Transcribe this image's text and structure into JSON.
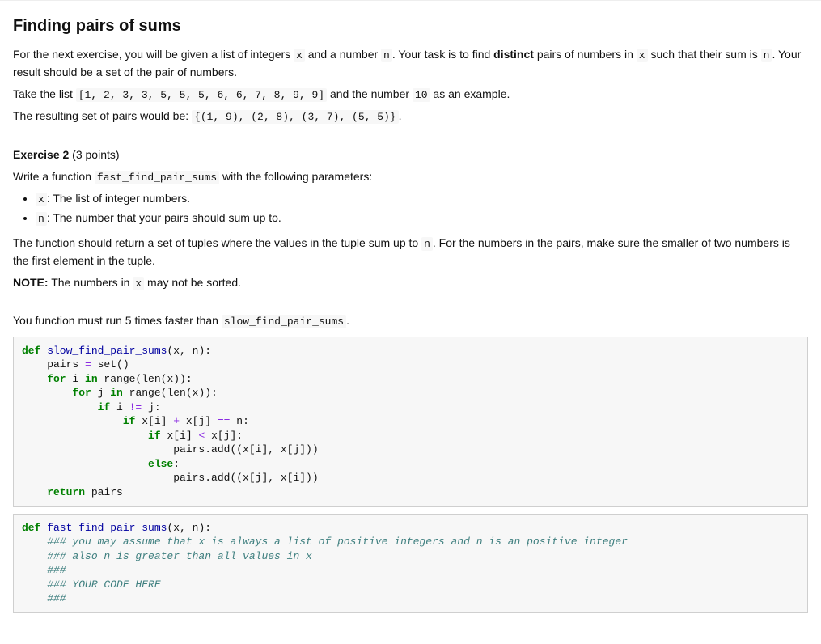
{
  "title": "Finding pairs of sums",
  "intro_p1_a": "For the next exercise, you will be given a list of integers ",
  "intro_p1_b": " and a number ",
  "intro_p1_c": ". Your task is to find ",
  "intro_p1_bold": "distinct",
  "intro_p1_d": " pairs of numbers in ",
  "intro_p1_e": " such that their sum is ",
  "intro_p1_f": ". Your result should be a set of the pair of numbers.",
  "intro_p2_a": "Take the list ",
  "intro_p2_list": "[1, 2, 3, 3, 5, 5, 5, 6, 6, 7, 8, 9, 9]",
  "intro_p2_b": " and the number ",
  "intro_p2_num": "10",
  "intro_p2_c": " as an example.",
  "intro_p3_a": "The resulting set of pairs would be: ",
  "intro_p3_set": "{(1, 9), (2, 8), (3, 7), (5, 5)}",
  "intro_p3_b": ".",
  "ex_label": "Exercise 2",
  "ex_points": " (3 points)",
  "ex_line_a": "Write a function ",
  "ex_fn": "fast_find_pair_sums",
  "ex_line_b": " with the following parameters:",
  "bullet_x_code": "x",
  "bullet_x_text": ": The list of integer numbers.",
  "bullet_n_code": "n",
  "bullet_n_text": ": The number that your pairs should sum up to.",
  "ret_a": "The function should return a set of tuples where the values in the tuple sum up to ",
  "ret_b": ". For the numbers in the pairs, make sure the smaller of two numbers is the first element in the tuple.",
  "note_label": "NOTE:",
  "note_a": " The numbers in ",
  "note_b": " may not be sorted.",
  "speed_a": "You function must run 5 times faster than ",
  "speed_fn": "slow_find_pair_sums",
  "speed_b": ".",
  "code_x": "x",
  "code_n": "n",
  "cell1": {
    "l1_def": "def",
    "l1_name": " slow_find_pair_sums",
    "l1_args": "(x, n):",
    "l2_a": "    pairs ",
    "l2_eq": "=",
    "l2_b": " set()",
    "l3_for": "    for",
    "l3_a": " i ",
    "l3_in": "in",
    "l3_b": " range(len(x)):",
    "l4_for": "        for",
    "l4_a": " j ",
    "l4_in": "in",
    "l4_b": " range(len(x)):",
    "l5_if": "            if",
    "l5_a": " i ",
    "l5_op": "!=",
    "l5_b": " j:",
    "l6_if": "                if",
    "l6_a": " x[i] ",
    "l6_op1": "+",
    "l6_b": " x[j] ",
    "l6_op2": "==",
    "l6_c": " n:",
    "l7_if": "                    if",
    "l7_a": " x[i] ",
    "l7_op": "<",
    "l7_b": " x[j]:",
    "l8": "                        pairs.add((x[i], x[j]))",
    "l9_else": "                    else",
    "l9_colon": ":",
    "l10": "                        pairs.add((x[j], x[i]))",
    "l11_ret": "    return",
    "l11_a": " pairs"
  },
  "cell2": {
    "l1_def": "def",
    "l1_name": " fast_find_pair_sums",
    "l1_args": "(x, n):",
    "l2": "    ### you may assume that x is always a list of positive integers and n is an positive integer",
    "l3": "    ### also n is greater than all values in x",
    "l4": "    ###",
    "l5": "    ### YOUR CODE HERE",
    "l6": "    ###"
  }
}
